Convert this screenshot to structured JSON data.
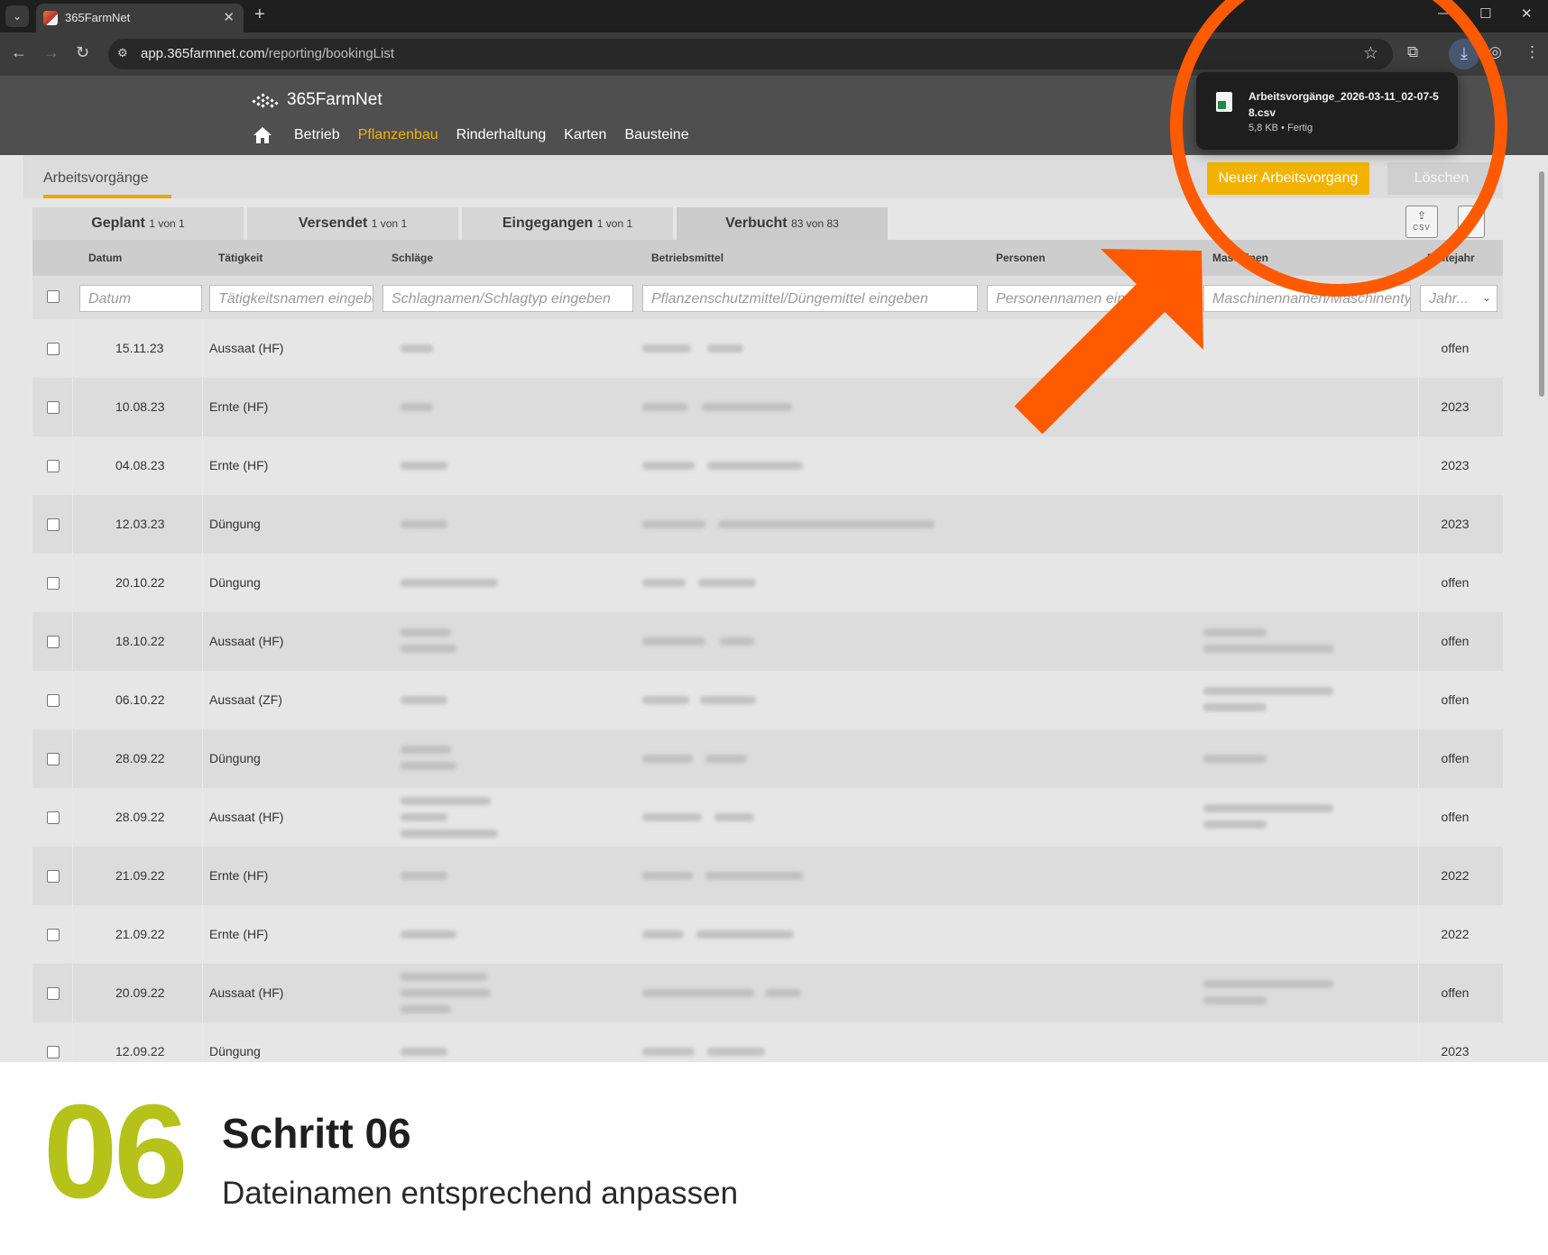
{
  "browser": {
    "tab_title": "365FarmNet",
    "url_host": "app.365farmnet.com",
    "url_path": "/reporting/bookingList"
  },
  "download": {
    "file_name": "Arbeitsvorgänge_2026-03-11_02-07-58.csv",
    "meta": "5,8 KB • Fertig"
  },
  "app": {
    "logo_text": "365FarmNet",
    "nav": [
      "Betrieb",
      "Pflanzenbau",
      "Rinderhaltung",
      "Karten",
      "Bausteine"
    ],
    "active_nav": "Pflanzenbau",
    "page_title": "Arbeitsvorgänge",
    "new_button": "Neuer Arbeitsvorgang",
    "delete_button": "Löschen",
    "csv_label": "CSV"
  },
  "subtabs": [
    {
      "label": "Geplant",
      "count": "1 von 1"
    },
    {
      "label": "Versendet",
      "count": "1 von 1"
    },
    {
      "label": "Eingegangen",
      "count": "1 von 1"
    },
    {
      "label": "Verbucht",
      "count": "83 von 83"
    }
  ],
  "columns": {
    "datum": "Datum",
    "taetigkeit": "Tätigkeit",
    "schlaege": "Schläge",
    "betriebsmittel": "Betriebsmittel",
    "personen": "Personen",
    "maschinen": "Maschinen",
    "erntejahr": "Erntejahr"
  },
  "filters": {
    "datum": "Datum",
    "taetigkeit": "Tätigkeitsnamen eingeben",
    "schlaege": "Schlagnamen/Schlagtyp eingeben",
    "betriebsmittel": "Pflanzenschutzmittel/Düngemittel eingeben",
    "personen": "Personennamen eingeben",
    "maschinen": "Maschinennamen/Maschinentyp eingeben",
    "jahr": "Jahr..."
  },
  "rows": [
    {
      "date": "15.11.23",
      "activity": "Aussaat (HF)",
      "year": "offen"
    },
    {
      "date": "10.08.23",
      "activity": "Ernte (HF)",
      "year": "2023"
    },
    {
      "date": "04.08.23",
      "activity": "Ernte (HF)",
      "year": "2023"
    },
    {
      "date": "12.03.23",
      "activity": "Düngung",
      "year": "2023"
    },
    {
      "date": "20.10.22",
      "activity": "Düngung",
      "year": "offen"
    },
    {
      "date": "18.10.22",
      "activity": "Aussaat (HF)",
      "year": "offen"
    },
    {
      "date": "06.10.22",
      "activity": "Aussaat (ZF)",
      "year": "offen"
    },
    {
      "date": "28.09.22",
      "activity": "Düngung",
      "year": "offen"
    },
    {
      "date": "28.09.22",
      "activity": "Aussaat (HF)",
      "year": "offen"
    },
    {
      "date": "21.09.22",
      "activity": "Ernte (HF)",
      "year": "2022"
    },
    {
      "date": "21.09.22",
      "activity": "Ernte (HF)",
      "year": "2022"
    },
    {
      "date": "20.09.22",
      "activity": "Aussaat (HF)",
      "year": "offen"
    },
    {
      "date": "12.09.22",
      "activity": "Düngung",
      "year": "2023"
    }
  ],
  "caption": {
    "number": "06",
    "title": "Schritt 06",
    "subtitle": "Dateinamen entsprechend anpassen"
  },
  "colors": {
    "accent": "#f2b300",
    "annotation": "#ff5a00",
    "step_number": "#b5c21a"
  }
}
